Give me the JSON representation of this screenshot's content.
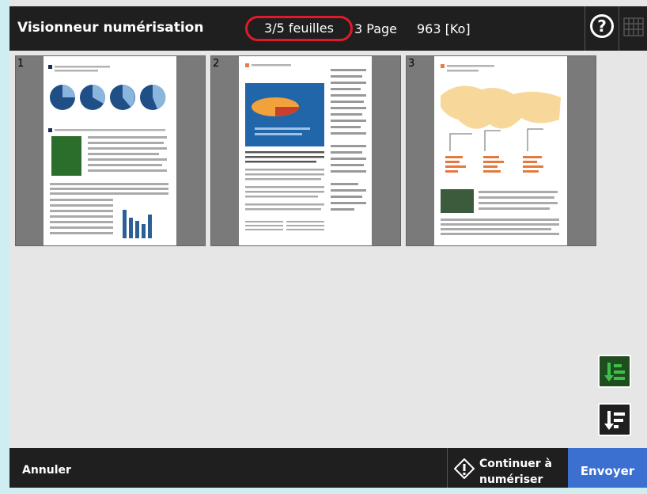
{
  "header": {
    "title": "Visionneur numérisation",
    "sheets": "3/5 feuilles",
    "pages": "3 Page",
    "size": "963 [Ko]",
    "help_label": "?"
  },
  "thumbnails": [
    {
      "number": "1"
    },
    {
      "number": "2"
    },
    {
      "number": "3"
    }
  ],
  "footer": {
    "cancel_label": "Annuler",
    "continue_label_line1": "Continuer à",
    "continue_label_line2": "numériser",
    "send_label": "Envoyer"
  },
  "colors": {
    "accent_blue": "#3b6fd0",
    "highlight_red": "#e0192b",
    "button_green": "#3fbf4a"
  }
}
